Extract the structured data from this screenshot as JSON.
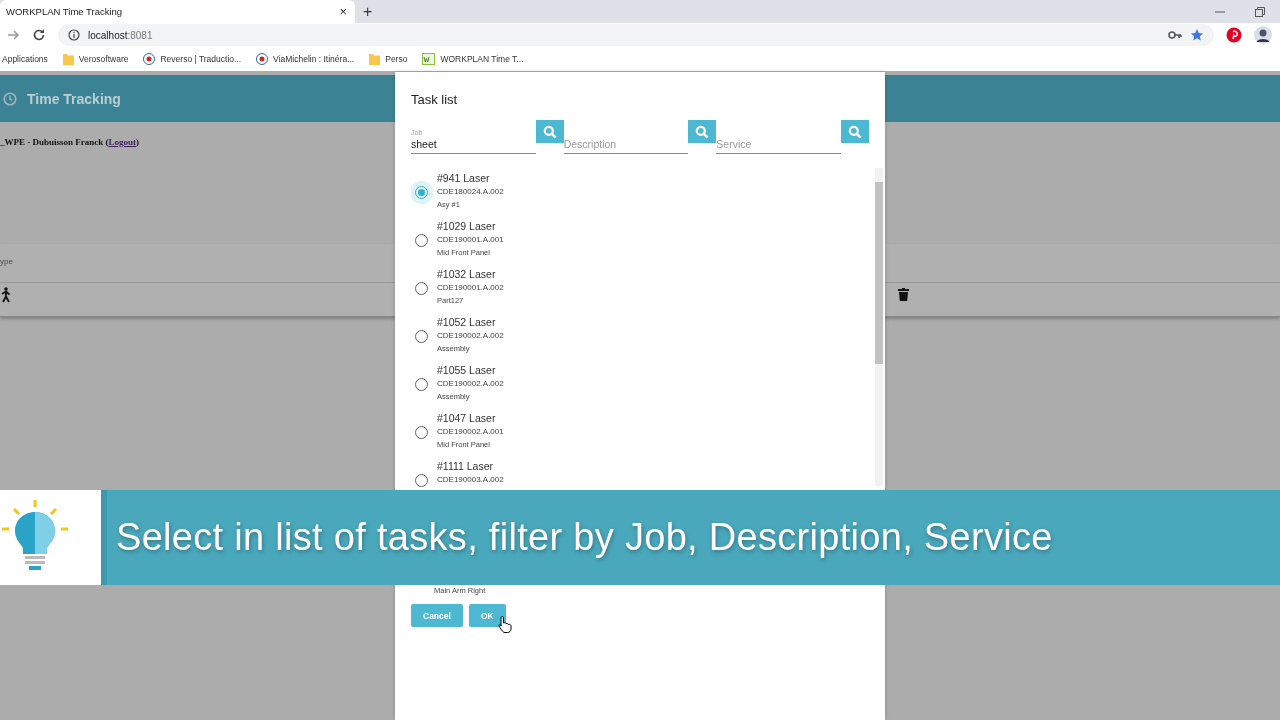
{
  "browser": {
    "tab_title": "WORKPLAN Time Tracking",
    "tab_close": "×",
    "new_tab": "+",
    "address_host": "localhost",
    "address_port": ":8081",
    "bookmarks": [
      {
        "label": "Applications",
        "kind": "apps"
      },
      {
        "label": "Verosoftware",
        "kind": "folder"
      },
      {
        "label": "Reverso | Traductio...",
        "kind": "site"
      },
      {
        "label": "ViaMichelin : Itinéra...",
        "kind": "site"
      },
      {
        "label": "Perso",
        "kind": "folder"
      },
      {
        "label": "WORKPLAN Time T...",
        "kind": "wp"
      }
    ]
  },
  "app": {
    "title": "Time Tracking",
    "user": "_WPE - Dubuisson Franck (",
    "logout": "Logout",
    "user_end": ")",
    "type_label": "ype"
  },
  "dialog": {
    "title": "Task list",
    "filters": [
      {
        "label": "Job",
        "value": "sheet"
      },
      {
        "placeholder": "Description"
      },
      {
        "placeholder": "Service"
      }
    ],
    "tasks": [
      {
        "name": "#941 Laser",
        "code": "CDE180024.A.002",
        "note": "Asy #1",
        "selected": true
      },
      {
        "name": "#1029 Laser",
        "code": "CDE190001.A.001",
        "note": "Mid Front Panel",
        "selected": false
      },
      {
        "name": "#1032 Laser",
        "code": "CDE190001.A.002",
        "note": "Part127",
        "selected": false
      },
      {
        "name": "#1052 Laser",
        "code": "CDE190002.A.002",
        "note": "Assembly",
        "selected": false
      },
      {
        "name": "#1055 Laser",
        "code": "CDE190002.A.002",
        "note": "Assembly",
        "selected": false
      },
      {
        "name": "#1047 Laser",
        "code": "CDE190002.A.001",
        "note": "Mid Front Panel",
        "selected": false
      },
      {
        "name": "#1111 Laser",
        "code": "CDE190003.A.002",
        "selected": false
      }
    ],
    "list_bottom_note": "Main Arm Right",
    "buttons": [
      "Cancel",
      "OK"
    ]
  },
  "banner": {
    "text": "Select in list of tasks, filter by Job, Description, Service"
  }
}
